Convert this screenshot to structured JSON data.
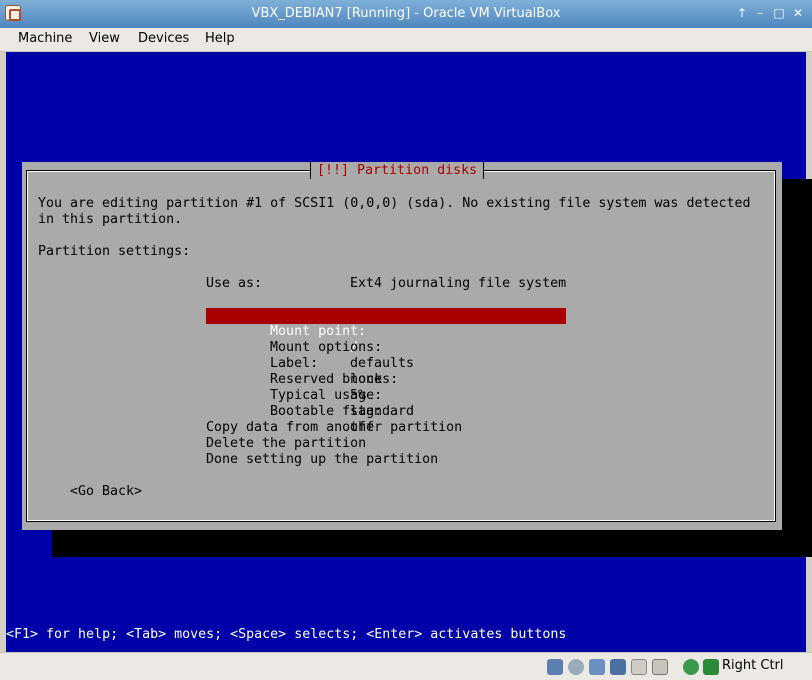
{
  "window": {
    "title": "VBX_DEBIAN7 [Running] - Oracle VM VirtualBox",
    "controls": [
      "↑",
      "–",
      "□",
      "✕"
    ]
  },
  "menu": [
    "Machine",
    "View",
    "Devices",
    "Help"
  ],
  "dialog": {
    "title": "[!!] Partition disks",
    "intro_line1": "You are editing partition #1 of SCSI1 (0,0,0) (sda). No existing file system was detected",
    "intro_line2": "in this partition.",
    "settings_heading": "Partition settings:",
    "use_as_label": "Use as:",
    "use_as_value": "Ext4 journaling file system",
    "options": [
      {
        "label": "Mount point:",
        "value": "/"
      },
      {
        "label": "Mount options:",
        "value": "defaults"
      },
      {
        "label": "Label:",
        "value": "none"
      },
      {
        "label": "Reserved blocks:",
        "value": "5%"
      },
      {
        "label": "Typical usage:",
        "value": "standard"
      },
      {
        "label": "Bootable flag:",
        "value": "off"
      }
    ],
    "actions": [
      "Copy data from another partition",
      "Delete the partition",
      "Done setting up the partition"
    ],
    "go_back": "<Go Back>"
  },
  "help_line": "<F1> for help; <Tab> moves; <Space> selects; <Enter> activates buttons",
  "statusbar": {
    "host_key": "Right Ctrl",
    "icons": [
      "hard-disk-icon",
      "optical-drive-icon",
      "usb-icon",
      "network-icon",
      "shared-folder-icon",
      "display-icon",
      "recording-icon",
      "virtualization-icon",
      "mouse-integration-icon"
    ]
  },
  "colors": {
    "screen_bg": "#0000a8",
    "dialog_bg": "#aaaaaa",
    "highlight": "#a80000",
    "title_red": "#a80000"
  }
}
